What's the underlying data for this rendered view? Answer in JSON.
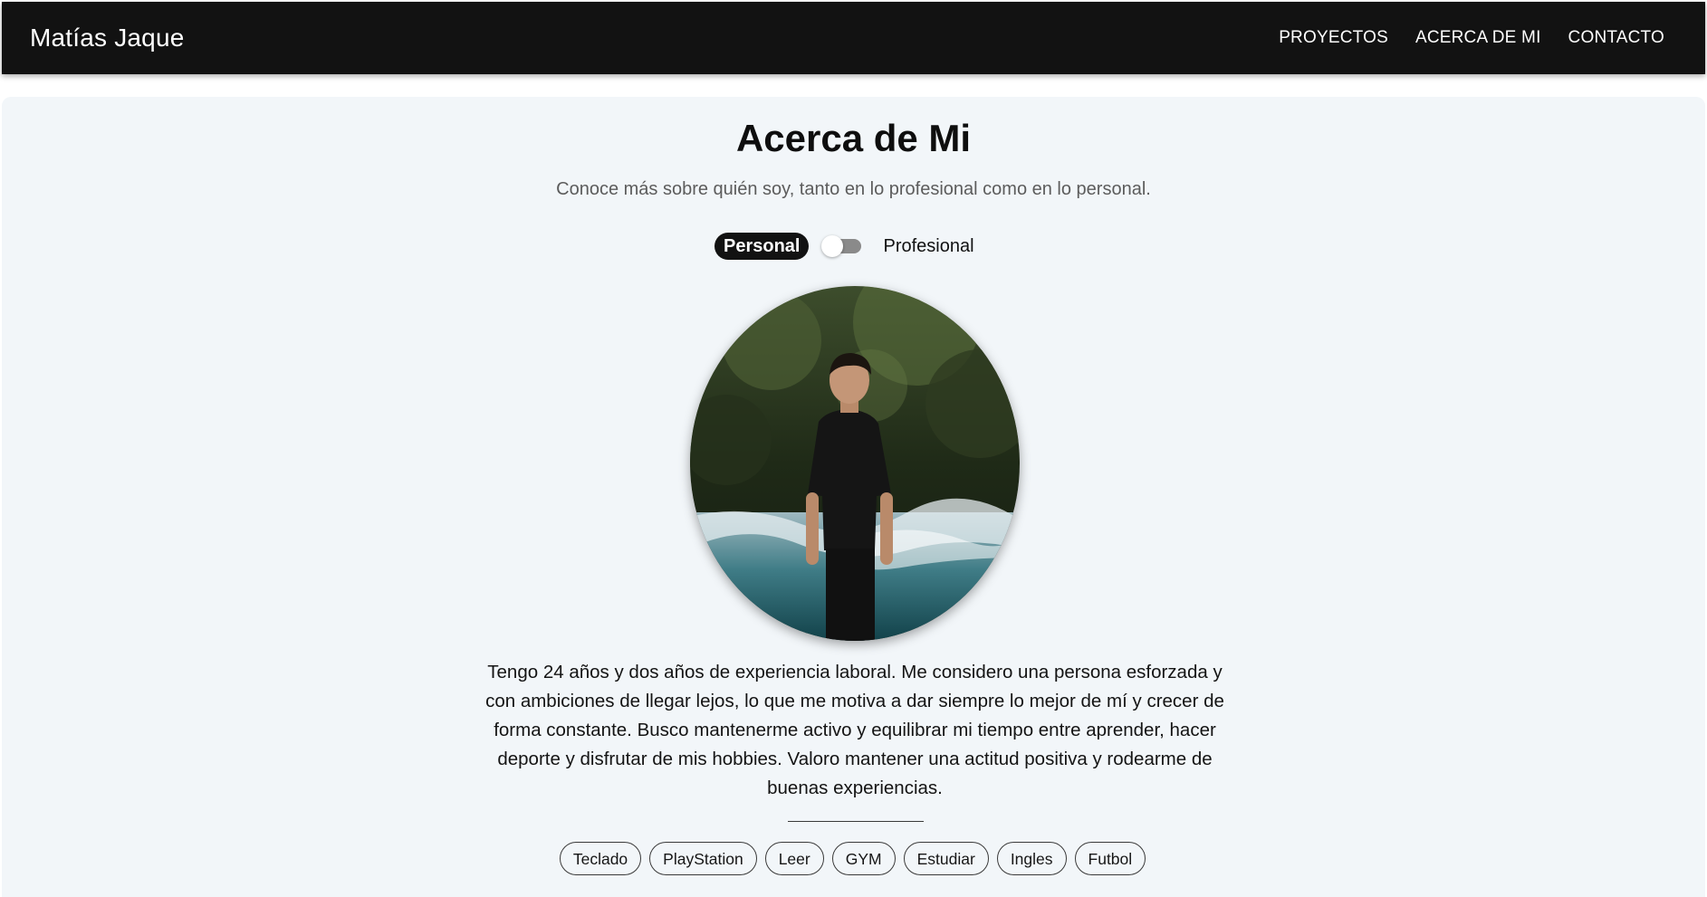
{
  "navbar": {
    "brand": "Matías Jaque",
    "links": [
      "PROYECTOS",
      "ACERCA DE MI",
      "CONTACTO"
    ]
  },
  "about": {
    "title": "Acerca de Mi",
    "subtitle": "Conoce más sobre quién soy, tanto en lo profesional como en lo personal.",
    "toggle": {
      "left_label": "Personal",
      "right_label": "Profesional",
      "state": "Personal"
    },
    "bio": "Tengo 24 años y dos años de experiencia laboral. Me considero una persona esforzada y con ambiciones de llegar lejos, lo que me motiva a dar siempre lo mejor de mí y crecer de forma constante. Busco mantenerme activo y equilibrar mi tiempo entre aprender, hacer deporte y disfrutar de mis hobbies. Valoro mantener una actitud positiva y rodearme de buenas experiencias.",
    "hobbies": [
      "Teclado",
      "PlayStation",
      "Leer",
      "GYM",
      "Estudiar",
      "Ingles",
      "Futbol"
    ]
  },
  "colors": {
    "navbar_bg": "#121212",
    "panel_bg": "#f2f6f9",
    "accent": "#121212"
  }
}
